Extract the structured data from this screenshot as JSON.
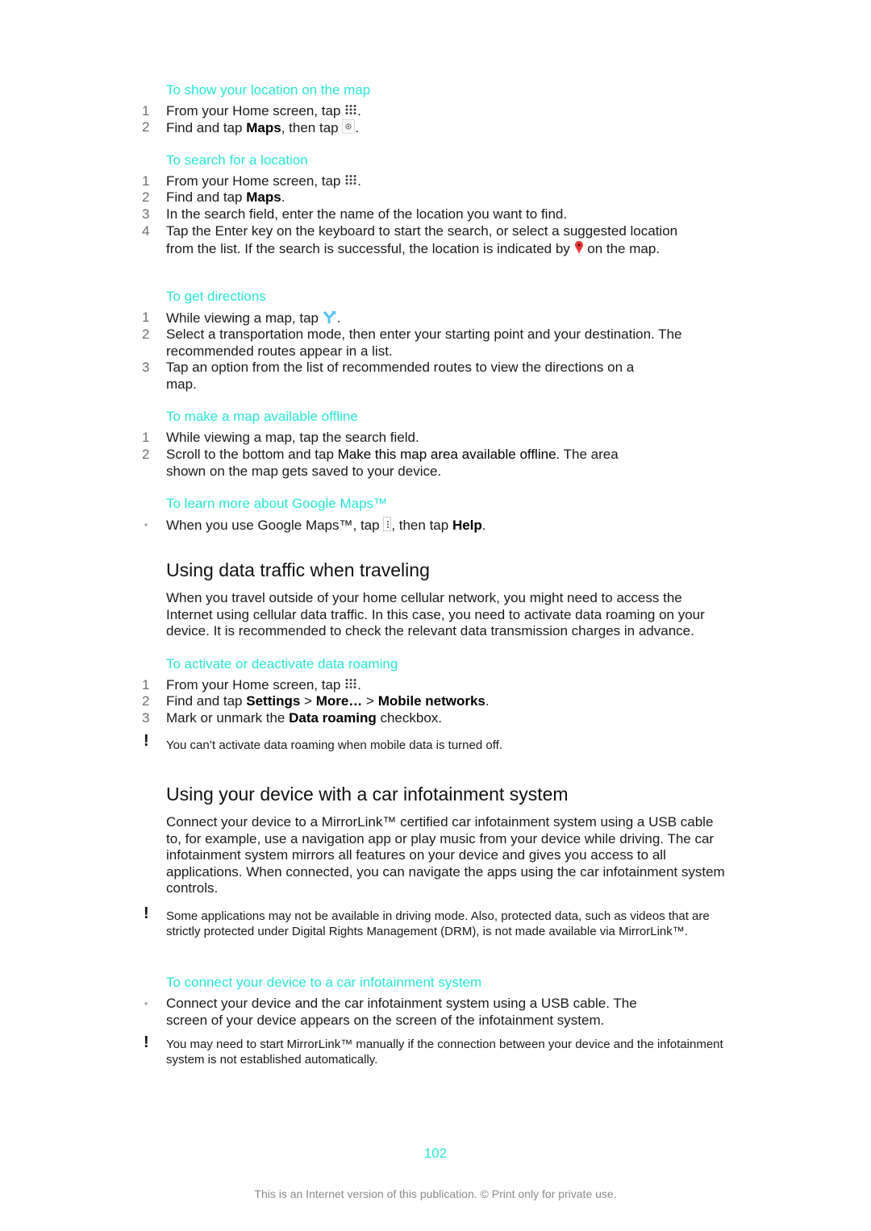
{
  "sections": {
    "show_location": {
      "title": "To show your location on the map",
      "steps": [
        {
          "num": "1",
          "pre": "From your Home screen, tap ",
          "icon": "apps-grid-icon",
          "post": "."
        },
        {
          "num": "2",
          "pre": "Find and tap ",
          "bold": "Maps",
          "mid": ", then tap ",
          "icon": "my-location-icon",
          "post": "."
        }
      ]
    },
    "search_location": {
      "title": "To search for a location",
      "steps": [
        {
          "num": "1",
          "pre": "From your Home screen, tap ",
          "icon": "apps-grid-icon",
          "post": "."
        },
        {
          "num": "2",
          "pre": "Find and tap ",
          "bold": "Maps",
          "post": "."
        },
        {
          "num": "3",
          "text": "In the search field, enter the name of the location you want to find."
        },
        {
          "num": "4",
          "pre": "Tap the Enter key on the keyboard to start the search, or select a suggested location from the list. If the search is successful, the location is indicated by ",
          "icon": "map-pin-icon",
          "post": " on the map."
        }
      ]
    },
    "get_directions": {
      "title": "To get directions",
      "steps": [
        {
          "num": "1",
          "pre": "While viewing a map, tap ",
          "icon": "directions-icon",
          "post": "."
        },
        {
          "num": "2",
          "text": "Select a transportation mode, then enter your starting point and your destination. The recommended routes appear in a list."
        },
        {
          "num": "3",
          "text": "Tap an option from the list of recommended routes to view the directions on a map."
        }
      ]
    },
    "offline": {
      "title": "To make a map available offline",
      "steps": [
        {
          "num": "1",
          "text": "While viewing a map, tap the search field."
        },
        {
          "num": "2",
          "pre": "Scroll to the bottom and tap ",
          "bold": "Make this map area available offline",
          "post": ". The area shown on the map gets saved to your device."
        }
      ]
    },
    "learn_more": {
      "title": "To learn more about Google Maps™",
      "bullet": {
        "pre": "When you use Google Maps™, tap ",
        "icon": "menu-icon",
        "mid": ", then tap ",
        "bold": "Help",
        "post": "."
      }
    },
    "data_traffic": {
      "heading": "Using data traffic when traveling",
      "paragraph": "When you travel outside of your home cellular network, you might need to access the Internet using cellular data traffic. In this case, you need to activate data roaming on your device. It is recommended to check the relevant data transmission charges in advance."
    },
    "roaming": {
      "title": "To activate or deactivate data roaming",
      "step1": {
        "num": "1",
        "pre": "From your Home screen, tap ",
        "post": "."
      },
      "step2": {
        "num": "2",
        "pre": "Find and tap ",
        "b1": "Settings",
        "sep1": " > ",
        "b2": "More…",
        "sep2": " > ",
        "b3": "Mobile networks",
        "post": "."
      },
      "step3": {
        "num": "3",
        "pre": "Mark or unmark the ",
        "bold": "Data roaming",
        "post": " checkbox."
      },
      "note": "You can’t activate data roaming when mobile data is turned off."
    },
    "car": {
      "heading": "Using your device with a car infotainment system",
      "paragraph": "Connect your device to a MirrorLink™ certified car infotainment system using a USB cable to, for example, use a navigation app or play music from your device while driving. The car infotainment system mirrors all features on your device and gives you access to all applications. When connected, you can navigate the apps using the car infotainment system controls.",
      "note1": "Some applications may not be available in driving mode. Also, protected data, such as videos that are strictly protected under Digital Rights Management (DRM), is not made available via MirrorLink™.",
      "connect_title": "To connect your device to a car infotainment system",
      "connect_bullet": "Connect your device and the car infotainment system using a USB cable. The screen of your device appears on the screen of the infotainment system.",
      "note2": "You may need to start MirrorLink™ manually if the connection between your device and the infotainment system is not established automatically."
    }
  },
  "page_number": "102",
  "footer": "This is an Internet version of this publication. © Print only for private use.",
  "colors": {
    "accent": "#28e6d6",
    "pin": "#e53935",
    "directions": "#4fc3f7"
  },
  "bullet_glyph": "•",
  "note_glyph": "!"
}
